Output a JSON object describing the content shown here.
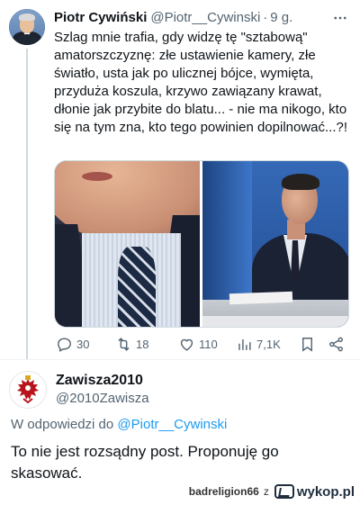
{
  "tweet": {
    "author_name": "Piotr Cywiński",
    "author_handle": "@Piotr__Cywinski",
    "separator": "·",
    "time": "9 g.",
    "more_icon": "more-horizontal-icon",
    "text": "Szlag mnie trafia, gdy widzę tę \"sztabową\" amatorszczyznę: złe ustawienie kamery, złe światło, usta jak po ulicznej bójce, wymięta, przyduża koszula, krzywo zawiązany krawat, dłonie jak przybite do blatu... - nie ma nikogo, kto się na tym zna, kto tego powinien dopilnować...?!",
    "media": [
      "tv-closeup-photo",
      "tv-studio-photo"
    ],
    "actions": {
      "replies": "30",
      "retweets": "18",
      "likes": "110",
      "views": "7,1K"
    }
  },
  "reply": {
    "author_name": "Zawisza2010",
    "author_handle": "@2010Zawisza",
    "replying_prefix": "W odpowiedzi do",
    "replying_to": "@Piotr__Cywinski",
    "text": "To nie jest rozsądny post. Proponuję go skasować."
  },
  "footer": {
    "username": "badreligion66",
    "by": "z",
    "site": "wykop.pl"
  },
  "colors": {
    "text_primary": "#0f1419",
    "text_secondary": "#536471",
    "link": "#1d9bf0",
    "divider": "#eff3f4"
  }
}
